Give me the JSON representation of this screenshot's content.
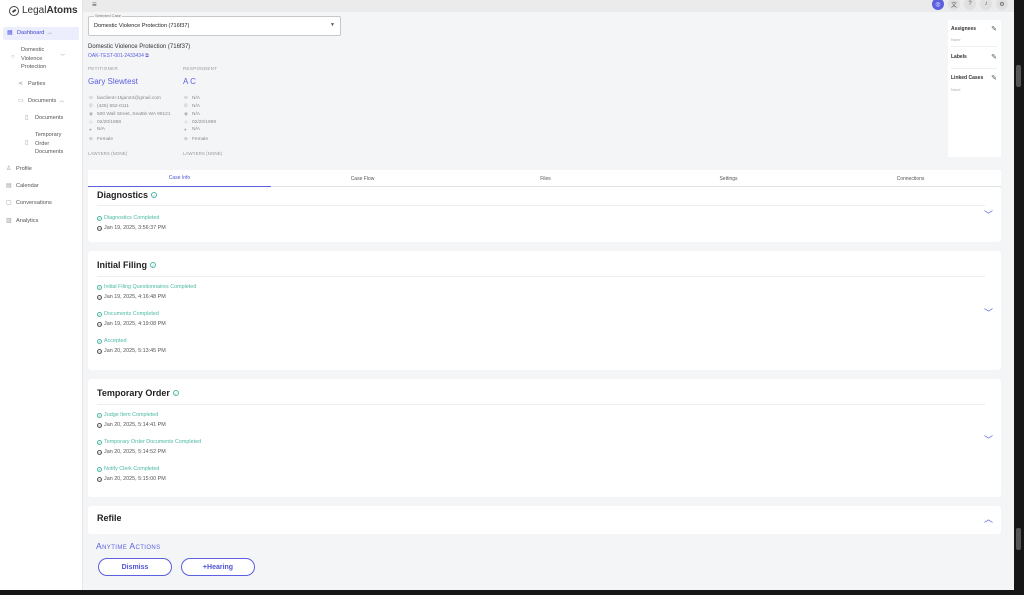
{
  "app": {
    "logo_light": "Legal",
    "logo_bold": "Atoms"
  },
  "sidebar": {
    "dashboard": "Dashboard",
    "case_line1": "Domestic",
    "case_line2": "Violence",
    "case_line3": "Protection",
    "parties": "Parties",
    "documents": "Documents",
    "documents_sub": "Documents",
    "temp_line1": "Temporary",
    "temp_line2": "Order",
    "temp_line3": "Documents",
    "profile": "Profile",
    "calendar": "Calendar",
    "conversations": "Conversations",
    "analytics": "Analytics"
  },
  "case_select": {
    "label": "Selected Case",
    "value": "Domestic Violence Protection (716f37)"
  },
  "case": {
    "title": "Domestic Violence Protection (716f37)",
    "id": "OAK-TEST-001-2433434"
  },
  "petitioner": {
    "heading": "PETITIONER",
    "name": "Gary Slewtest",
    "email": "laxclient+15jan24@gmail.com",
    "phone": "(425) 652-0111",
    "address": "500 Wall Street, Seattle WA 98121",
    "dob": "02/20/1998",
    "field5": "N/A",
    "gender": "Female",
    "lawyers": "LAWYERS (NONE)"
  },
  "respondent": {
    "heading": "RESPONDENT",
    "name": "A C",
    "email": "N/A",
    "phone": "N/A",
    "address": "N/A",
    "dob": "02/20/1999",
    "field5": "N/A",
    "gender": "Female",
    "lawyers": "LAWYERS (NONE)"
  },
  "side_panel": {
    "assignees": "Assignees",
    "assignees_val": "None",
    "labels": "Labels",
    "linked": "Linked Cases",
    "linked_val": "None"
  },
  "tabs": [
    "Case Info",
    "Case Flow",
    "Files",
    "Settings",
    "Connections"
  ],
  "sections": {
    "diagnostics": {
      "title": "Diagnostics",
      "steps": [
        {
          "status": "Diagnostics Completed",
          "time": "Jan 19, 2025, 3:56:37 PM"
        }
      ]
    },
    "initial_filing": {
      "title": "Initial Filing",
      "steps": [
        {
          "status": "Initial Filing Questionnaires Completed",
          "time": "Jan 19, 2025, 4:16:48 PM"
        },
        {
          "status": "Documents Completed",
          "time": "Jan 19, 2025, 4:19:08 PM"
        },
        {
          "status": "Accepted",
          "time": "Jan 20, 2025, 5:13:45 PM"
        }
      ]
    },
    "temporary_order": {
      "title": "Temporary Order",
      "steps": [
        {
          "status": "Judge Item Completed",
          "time": "Jan 20, 2025, 5:14:41 PM"
        },
        {
          "status": "Temporary Order Documents Completed",
          "time": "Jan 20, 2025, 5:14:52 PM"
        },
        {
          "status": "Notify Clerk Completed",
          "time": "Jan 20, 2025, 5:15:00 PM"
        }
      ]
    },
    "refile": {
      "title": "Refile"
    }
  },
  "anytime": {
    "title": "Anytime Actions",
    "dismiss": "Dismiss",
    "hearing": "+Hearing"
  },
  "colors": {
    "accent": "#5b5fe0",
    "success": "#4cb8a5"
  }
}
